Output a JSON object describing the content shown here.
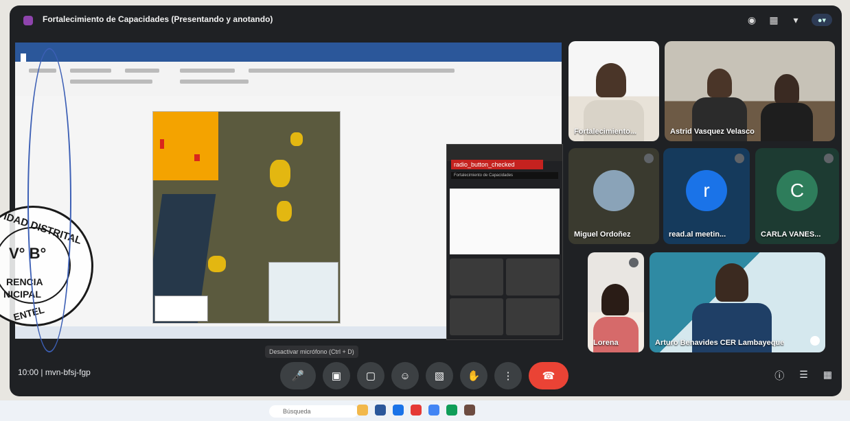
{
  "meeting": {
    "title": "Fortalecimiento de Capacidades (Presentando y anotando)",
    "meeting_code": "10:00 | mvn-bfsj-fgp",
    "tooltip": "Desactivar micrófono (Ctrl + D)"
  },
  "shared_panel": {
    "red_label": "radio_button_checked",
    "bar_text": "Fortalecimiento de Capacidades"
  },
  "participants": [
    {
      "name": "Fortalecimiento..."
    },
    {
      "name": "Astrid Vasquez Velasco"
    },
    {
      "name": "Miguel Ordoñez"
    },
    {
      "name": "read.al meetin...",
      "initial": "r",
      "color": "#1a73e8"
    },
    {
      "name": "CARLA VANES...",
      "initial": "C",
      "color": "#2e7d5b"
    },
    {
      "name": "Lorena"
    },
    {
      "name": "Arturo Benavides CER Lambayeque"
    }
  ],
  "windows_taskbar": {
    "search_placeholder": "Búsqueda"
  },
  "stamp": {
    "line1": "IDAD DISTRITAL",
    "line2": "V° B°",
    "line3": "RENCIA",
    "line4": "NICIPAL",
    "line5": "ENTEL"
  }
}
